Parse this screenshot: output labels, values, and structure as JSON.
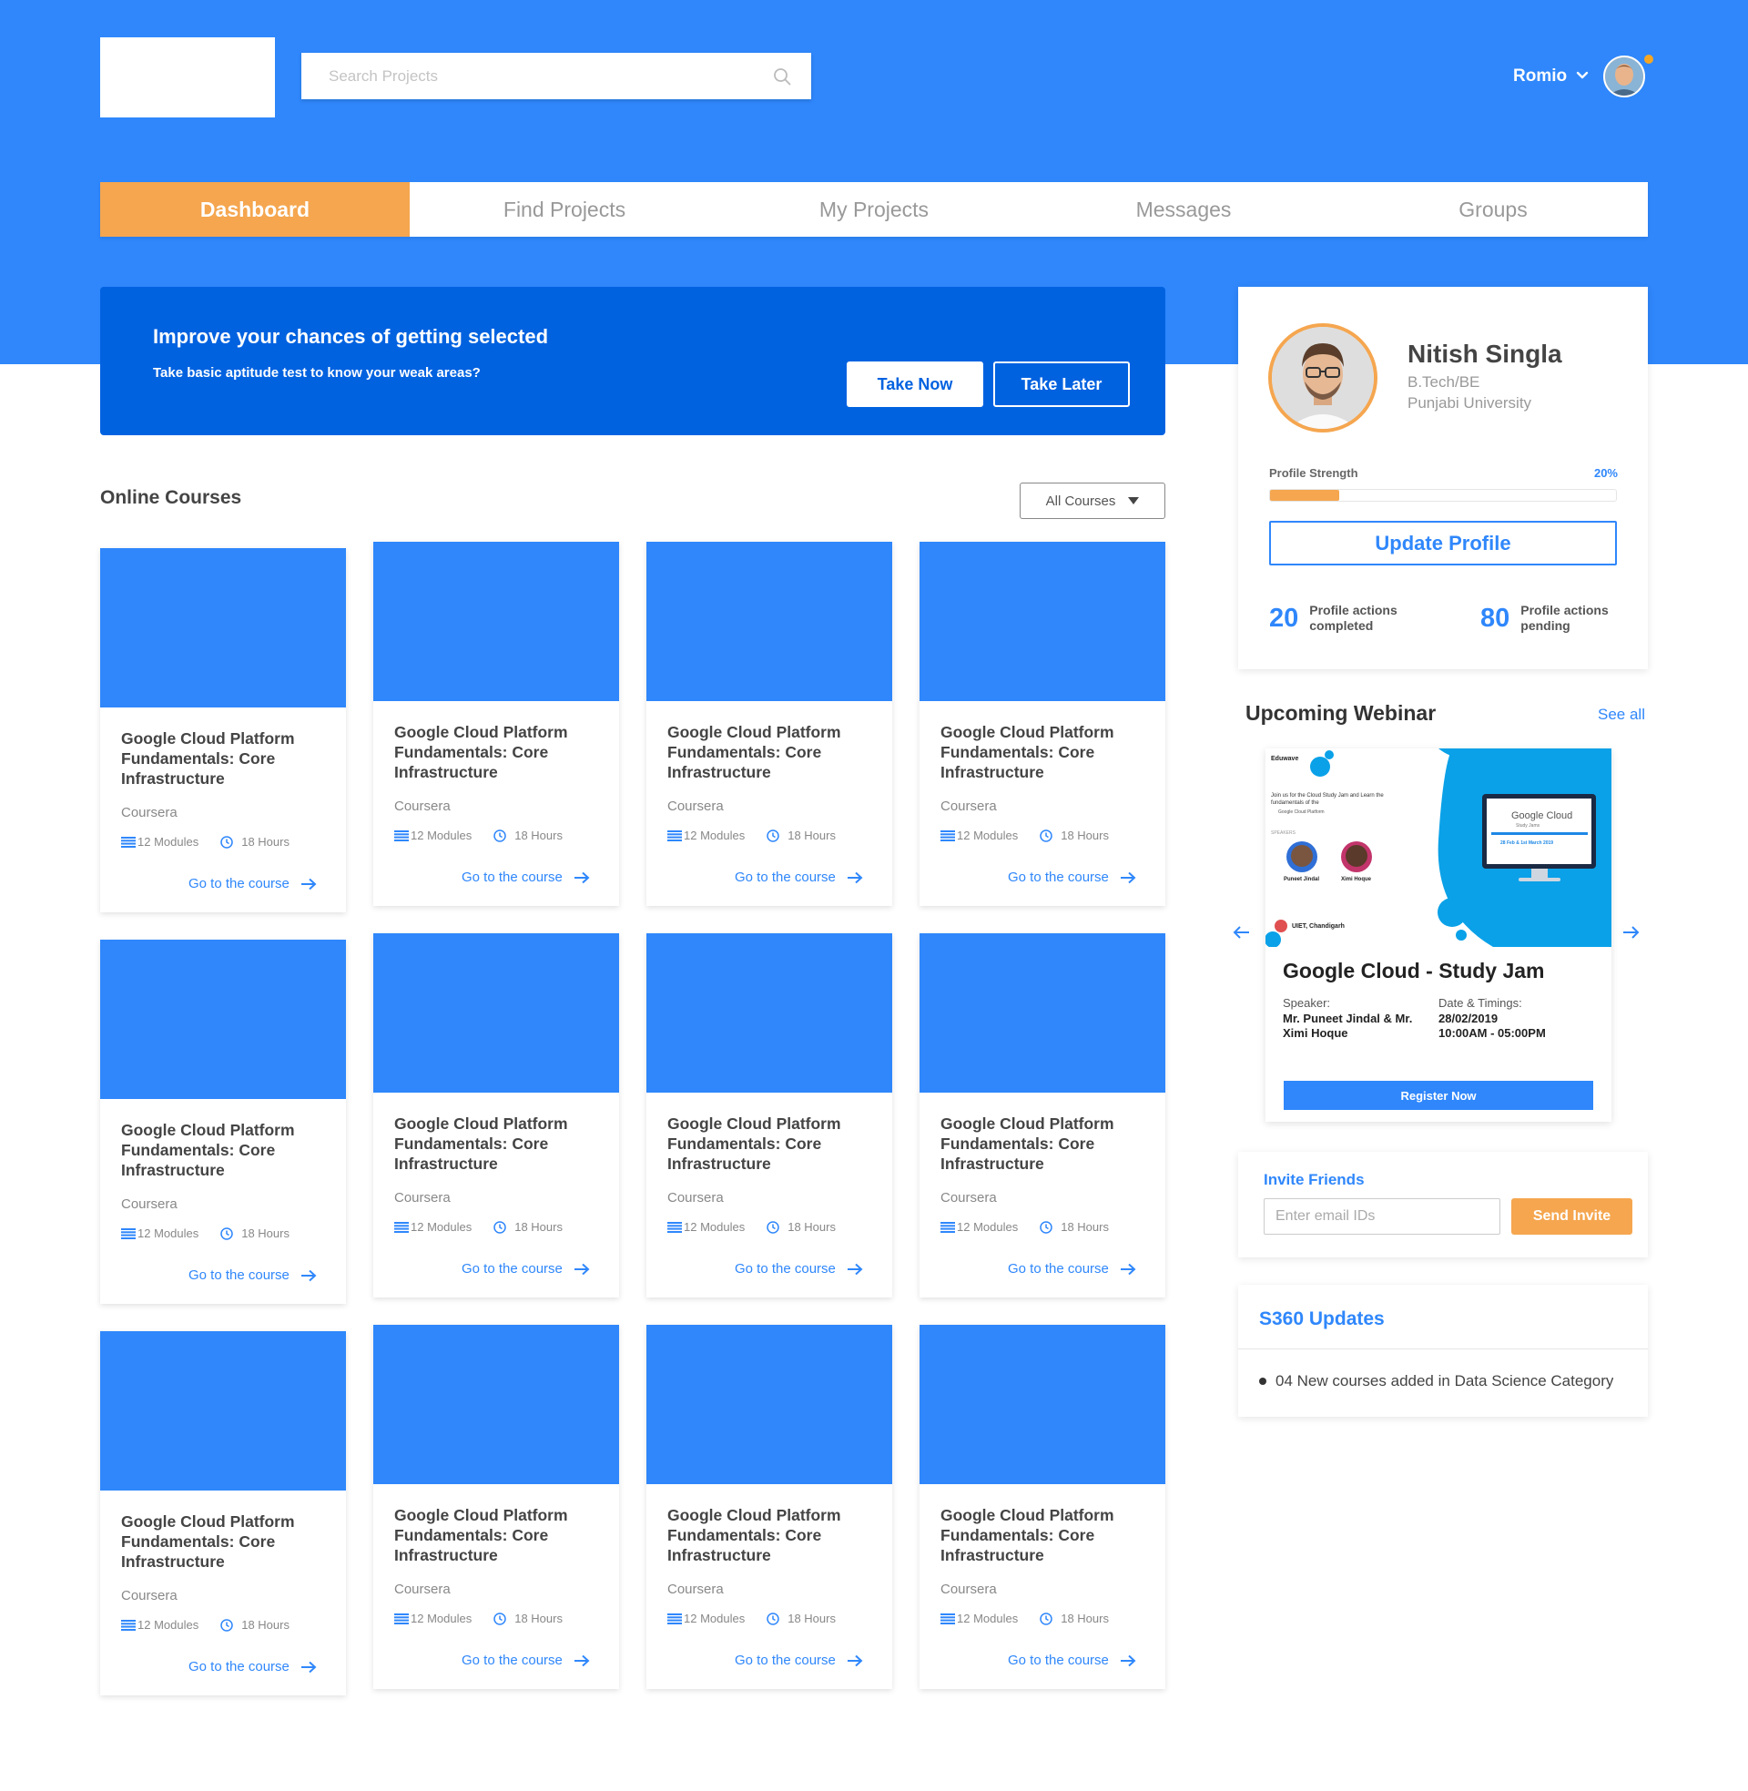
{
  "header": {
    "search_placeholder": "Search Projects",
    "user_name": "Romio"
  },
  "nav": {
    "tabs": [
      "Dashboard",
      "Find Projects",
      "My Projects",
      "Messages",
      "Groups"
    ],
    "active": "Dashboard"
  },
  "promo": {
    "title": "Improve your chances of getting selected",
    "subtitle": "Take basic aptitude test to know your weak areas?",
    "primary_label": "Take Now",
    "secondary_label": "Take Later"
  },
  "courses": {
    "section_title": "Online Courses",
    "filter_label": "All Courses",
    "items": [
      {
        "title": "Google Cloud Platform Fundamentals: Core Infrastructure",
        "provider": "Coursera",
        "modules": "12 Modules",
        "hours": "18 Hours",
        "link": "Go to the course"
      },
      {
        "title": "Google Cloud Platform Fundamentals: Core Infrastructure",
        "provider": "Coursera",
        "modules": "12 Modules",
        "hours": "18 Hours",
        "link": "Go to the course"
      },
      {
        "title": "Google Cloud Platform Fundamentals: Core Infrastructure",
        "provider": "Coursera",
        "modules": "12 Modules",
        "hours": "18 Hours",
        "link": "Go to the course"
      },
      {
        "title": "Google Cloud Platform Fundamentals: Core Infrastructure",
        "provider": "Coursera",
        "modules": "12 Modules",
        "hours": "18 Hours",
        "link": "Go to the course"
      },
      {
        "title": "Google Cloud Platform Fundamentals: Core Infrastructure",
        "provider": "Coursera",
        "modules": "12 Modules",
        "hours": "18 Hours",
        "link": "Go to the course"
      },
      {
        "title": "Google Cloud Platform Fundamentals: Core Infrastructure",
        "provider": "Coursera",
        "modules": "12 Modules",
        "hours": "18 Hours",
        "link": "Go to the course"
      },
      {
        "title": "Google Cloud Platform Fundamentals: Core Infrastructure",
        "provider": "Coursera",
        "modules": "12 Modules",
        "hours": "18 Hours",
        "link": "Go to the course"
      },
      {
        "title": "Google Cloud Platform Fundamentals: Core Infrastructure",
        "provider": "Coursera",
        "modules": "12 Modules",
        "hours": "18 Hours",
        "link": "Go to the course"
      },
      {
        "title": "Google Cloud Platform Fundamentals: Core Infrastructure",
        "provider": "Coursera",
        "modules": "12 Modules",
        "hours": "18 Hours",
        "link": "Go to the course"
      },
      {
        "title": "Google Cloud Platform Fundamentals: Core Infrastructure",
        "provider": "Coursera",
        "modules": "12 Modules",
        "hours": "18 Hours",
        "link": "Go to the course"
      },
      {
        "title": "Google Cloud Platform Fundamentals: Core Infrastructure",
        "provider": "Coursera",
        "modules": "12 Modules",
        "hours": "18 Hours",
        "link": "Go to the course"
      },
      {
        "title": "Google Cloud Platform Fundamentals: Core Infrastructure",
        "provider": "Coursera",
        "modules": "12 Modules",
        "hours": "18 Hours",
        "link": "Go to the course"
      }
    ]
  },
  "profile": {
    "name": "Nitish Singla",
    "degree": "B.Tech/BE",
    "university": "Punjabi University",
    "strength_label": "Profile Strength",
    "strength_value": "20%",
    "strength_fraction": 0.2,
    "update_label": "Update Profile",
    "completed_count": "20",
    "completed_label": "Profile actions completed",
    "pending_count": "80",
    "pending_label": "Profile actions pending"
  },
  "webinar": {
    "section_title": "Upcoming Webinar",
    "see_all": "See all",
    "poster": {
      "brand": "Eduwave",
      "blurb": "Join us for the Cloud Study Jam and Learn the fundamentals of the",
      "platform": "Google Cloud Platform",
      "speakers_label": "SPEAKERS",
      "speaker1": "Puneet Jindal",
      "speaker2": "Ximi Hoque",
      "venue": "UIET, Chandigarh",
      "screen_title": "Google Cloud",
      "screen_sub": "Study Jams",
      "screen_dates": "28 Feb & 1st March 2019"
    },
    "name": "Google Cloud - Study Jam",
    "speaker_label": "Speaker:",
    "speaker_value": "Mr. Puneet Jindal & Mr. Ximi Hoque",
    "date_label": "Date & Timings:",
    "date_value": "28/02/2019",
    "time_value": "10:00AM - 05:00PM",
    "register_label": "Register Now"
  },
  "invite": {
    "title": "Invite Friends",
    "placeholder": "Enter email IDs",
    "button_label": "Send Invite"
  },
  "updates": {
    "title": "S360 Updates",
    "items": [
      "04 New courses added in Data Science Category"
    ]
  },
  "colors": {
    "primary": "#2f87fb",
    "promo": "#0162e0",
    "accent": "#f5a64f"
  },
  "icons": {
    "search": "search-icon",
    "chevron": "chevron-down-icon",
    "modules": "list-icon",
    "hours": "clock-icon",
    "link_arrow": "arrow-right-icon",
    "carousel_prev": "arrow-left-icon",
    "carousel_next": "arrow-right-icon"
  }
}
